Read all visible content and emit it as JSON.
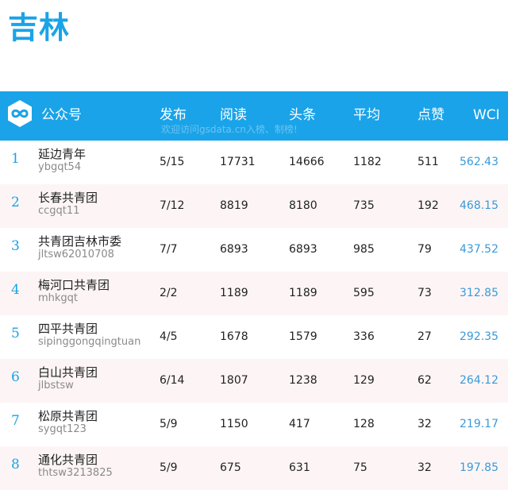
{
  "page": {
    "title": "吉林"
  },
  "header": {
    "account_label": "公众号",
    "publish_label": "发布",
    "read_label": "阅读",
    "headline_label": "头条",
    "average_label": "平均",
    "like_label": "点赞",
    "wci_label": "WCI",
    "watermark": "欢迎访问gsdata.cn入榜、制榜!",
    "logo_icon": "gsdata-infinity-logo-icon"
  },
  "colors": {
    "accent": "#1aa3e8",
    "alt_row": "#fdf5f5",
    "wci_text": "#3a9ad9"
  },
  "rows": [
    {
      "rank": "1",
      "name": "延边青年",
      "account": "ybgqt54",
      "publish": "5/15",
      "read": "17731",
      "headline": "14666",
      "average": "1182",
      "like": "511",
      "wci": "562.43"
    },
    {
      "rank": "2",
      "name": "长春共青团",
      "account": "ccgqt11",
      "publish": "7/12",
      "read": "8819",
      "headline": "8180",
      "average": "735",
      "like": "192",
      "wci": "468.15"
    },
    {
      "rank": "3",
      "name": "共青团吉林市委",
      "account": "jltsw62010708",
      "publish": "7/7",
      "read": "6893",
      "headline": "6893",
      "average": "985",
      "like": "79",
      "wci": "437.52"
    },
    {
      "rank": "4",
      "name": "梅河口共青团",
      "account": "mhkgqt",
      "publish": "2/2",
      "read": "1189",
      "headline": "1189",
      "average": "595",
      "like": "73",
      "wci": "312.85"
    },
    {
      "rank": "5",
      "name": "四平共青团",
      "account": "sipinggongqingtuan",
      "publish": "4/5",
      "read": "1678",
      "headline": "1579",
      "average": "336",
      "like": "27",
      "wci": "292.35"
    },
    {
      "rank": "6",
      "name": "白山共青团",
      "account": "jlbstsw",
      "publish": "6/14",
      "read": "1807",
      "headline": "1238",
      "average": "129",
      "like": "62",
      "wci": "264.12"
    },
    {
      "rank": "7",
      "name": "松原共青团",
      "account": "sygqt123",
      "publish": "5/9",
      "read": "1150",
      "headline": "417",
      "average": "128",
      "like": "32",
      "wci": "219.17"
    },
    {
      "rank": "8",
      "name": "通化共青团",
      "account": "thtsw3213825",
      "publish": "5/9",
      "read": "675",
      "headline": "631",
      "average": "75",
      "like": "32",
      "wci": "197.85"
    }
  ]
}
